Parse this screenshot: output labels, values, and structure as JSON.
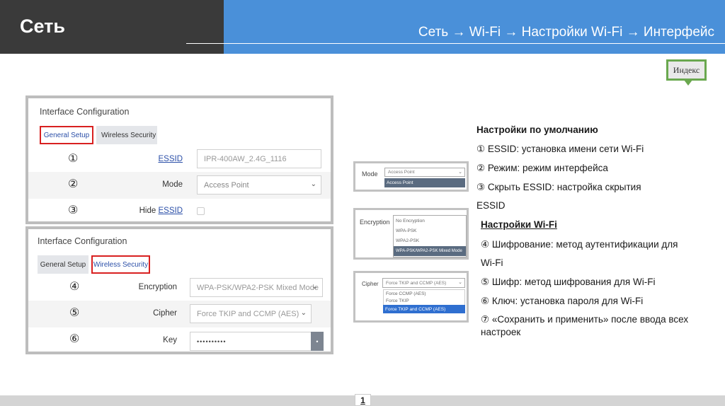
{
  "header": {
    "title": "Сеть",
    "breadcrumb": "Сеть → Wi-Fi → Настройки Wi-Fi → Интерфейс"
  },
  "index_button": "Индекс",
  "panel1": {
    "title": "Interface Configuration",
    "tabs": [
      "General Setup",
      "Wireless Security"
    ],
    "rows": [
      {
        "num": "①",
        "label": "ESSID",
        "value": "IPR-400AW_2.4G_1116"
      },
      {
        "num": "②",
        "label": "Mode",
        "value": "Access Point"
      },
      {
        "num": "③",
        "label_prefix": "Hide ",
        "label": "ESSID"
      }
    ]
  },
  "panel2": {
    "title": "Interface Configuration",
    "tabs": [
      "General Setup",
      "Wireless Security"
    ],
    "rows": [
      {
        "num": "④",
        "label": "Encryption",
        "value": "WPA-PSK/WPA2-PSK Mixed Mode"
      },
      {
        "num": "⑤",
        "label": "Cipher",
        "value": "Force TKIP and CCMP (AES)"
      },
      {
        "num": "⑥",
        "label": "Key",
        "value": "••••••••••"
      }
    ]
  },
  "dropdowns": {
    "mode": {
      "caption": "Mode",
      "selected": "Access Point",
      "options": [
        "Access Point"
      ]
    },
    "encryption": {
      "caption": "Encryption",
      "options": [
        "No Encryption",
        "WPA-PSK",
        "WPA2-PSK",
        "WPA-PSK/WPA2-PSK Mixed Mode"
      ]
    },
    "cipher": {
      "caption": "Cipher",
      "selected": "Force TKIP and CCMP (AES)",
      "options": [
        "Force CCMP (AES)",
        "Force TKIP",
        "Force TKIP and CCMP (AES)"
      ]
    }
  },
  "notes": {
    "h1": "Настройки по умолчанию",
    "l1": "① ESSID: установка имени сети Wi-Fi",
    "l2": "② Режим: режим интерфейса",
    "l3": "③ Скрыть ESSID: настройка скрытия",
    "l3b": "ESSID",
    "h2": "Настройки Wi-Fi",
    "l4": "④ Шифрование: метод аутентификации для",
    "l4b": "Wi-Fi",
    "l5": "⑤ Шифр: метод шифрования для Wi-Fi",
    "l6": "⑥ Ключ: установка пароля для Wi-Fi",
    "l7": "⑦ «Сохранить и применить» после ввода всех",
    "l7b": "настроек"
  },
  "footer": {
    "page": "1"
  },
  "colors": {
    "header_dark": "#3a3a3a",
    "header_blue": "#4a90d9",
    "accent_red": "#d82020",
    "index_green": "#6aa84f"
  }
}
